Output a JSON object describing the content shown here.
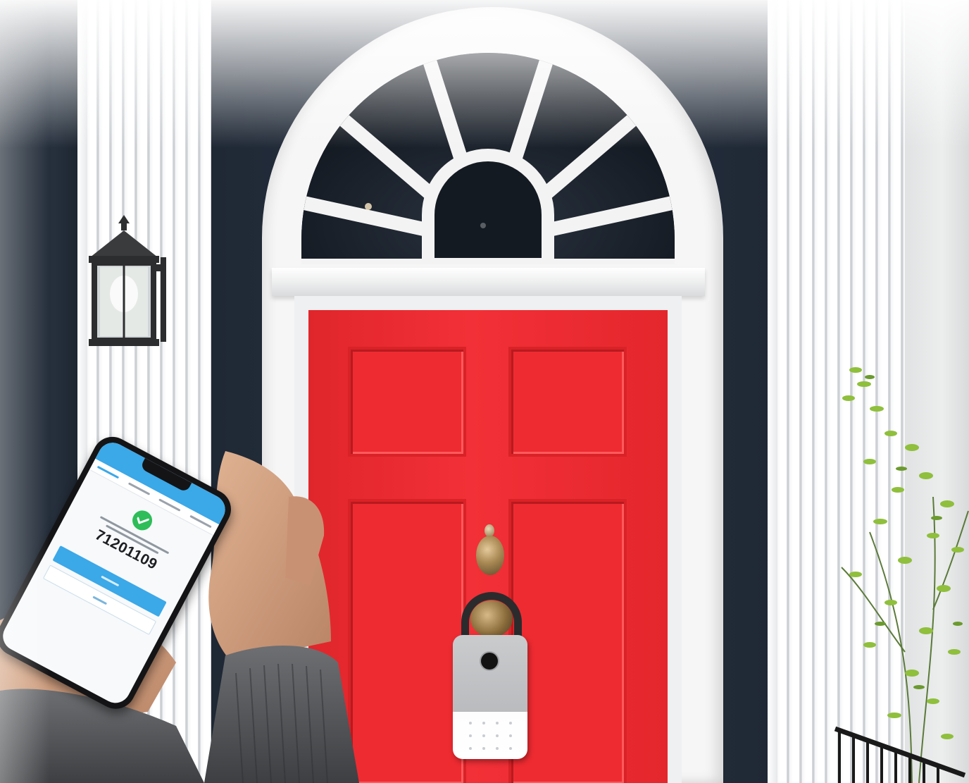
{
  "scene": {
    "door_color": "#f0282e",
    "wall_color": "#232d3a",
    "trim_color": "#f6f6f6"
  },
  "phone": {
    "app_bar_color": "#3ba8e8",
    "success_color": "#2ebd59",
    "password": "71201109"
  },
  "icons": [
    "check-icon",
    "fingerprint-sensor-icon",
    "keypad-icon"
  ]
}
